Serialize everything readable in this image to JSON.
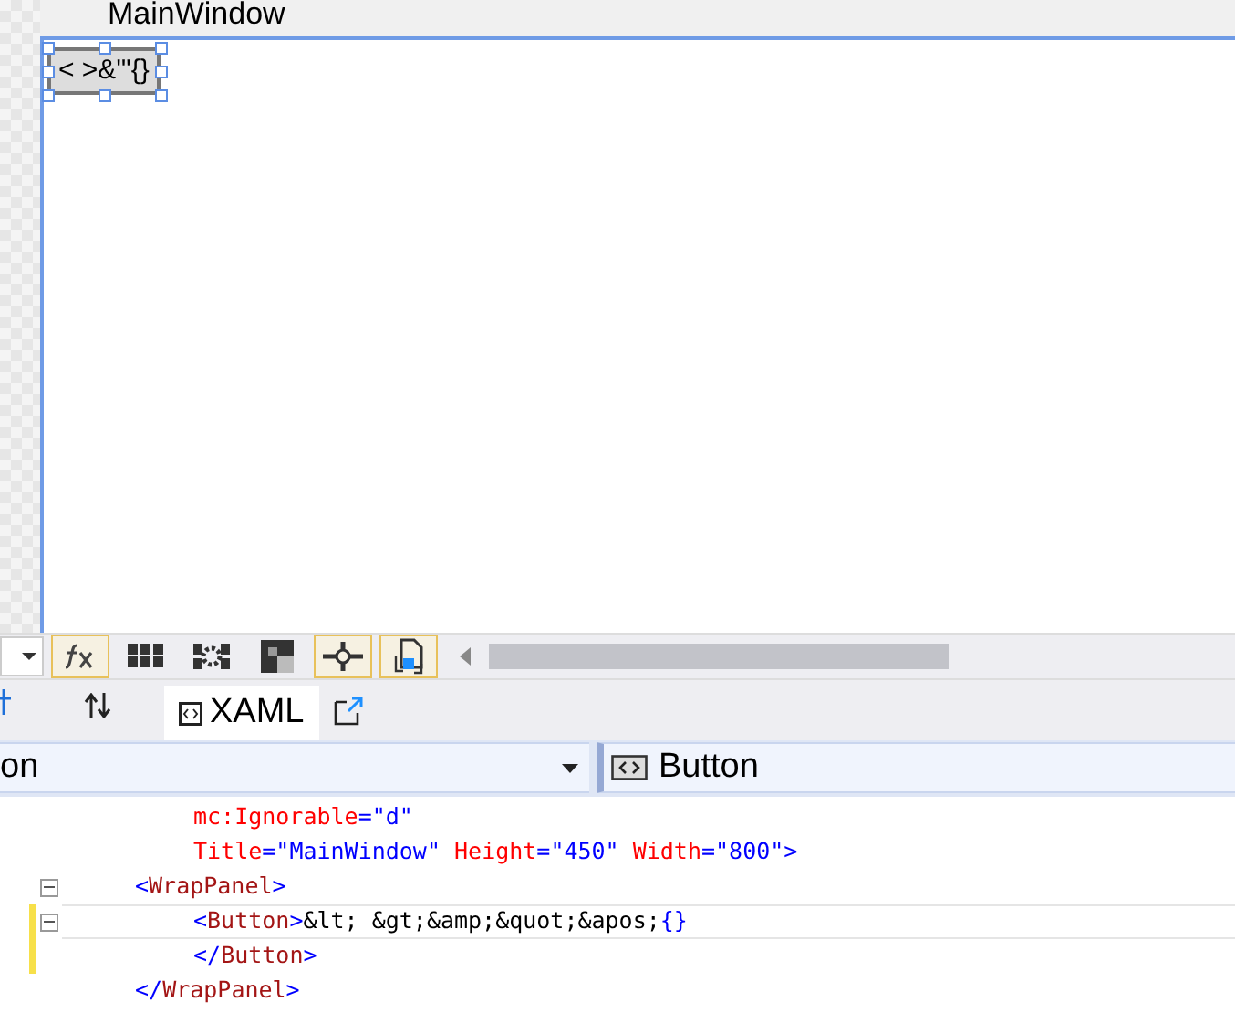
{
  "designer": {
    "window_title": "MainWindow",
    "button_content": "< >&\"'{}",
    "button_selected": true
  },
  "toolbar": {
    "tools": [
      {
        "kind": "fx",
        "on": true
      },
      {
        "kind": "grid",
        "on": false
      },
      {
        "kind": "grid-gear",
        "on": false
      },
      {
        "kind": "checker",
        "on": false
      },
      {
        "kind": "snap",
        "on": true
      },
      {
        "kind": "refresh-doc",
        "on": true
      }
    ]
  },
  "tabs": [
    {
      "label": "XAML",
      "selected": true
    }
  ],
  "selectors": [
    {
      "text": "on",
      "kind": "plain"
    },
    {
      "text": "Button",
      "kind": "element"
    }
  ],
  "code_lines": [
    {
      "kind": "attribute",
      "collapsible": false,
      "changed": false,
      "current": false,
      "tokens": [
        {
          "kind": "attr",
          "text": "mc:Ignorable"
        },
        {
          "kind": "punct",
          "text": "="
        },
        {
          "kind": "value",
          "text": "\"d\""
        }
      ]
    },
    {
      "kind": "attribute",
      "collapsible": false,
      "changed": false,
      "current": false,
      "tokens": [
        {
          "kind": "attr",
          "text": "Title"
        },
        {
          "kind": "punct",
          "text": "="
        },
        {
          "kind": "value",
          "text": "\"MainWindow\" "
        },
        {
          "kind": "attr",
          "text": "Height"
        },
        {
          "kind": "punct",
          "text": "="
        },
        {
          "kind": "value",
          "text": "\"450\" "
        },
        {
          "kind": "attr",
          "text": "Width"
        },
        {
          "kind": "punct",
          "text": "="
        },
        {
          "kind": "value",
          "text": "\"800\""
        },
        {
          "kind": "punct",
          "text": ">"
        }
      ]
    },
    {
      "kind": "tag",
      "collapsible": true,
      "changed": false,
      "current": false,
      "tokens": [
        {
          "kind": "punct",
          "text": "<"
        },
        {
          "kind": "element",
          "text": "WrapPanel"
        },
        {
          "kind": "punct",
          "text": ">"
        }
      ],
      "children": [
        {
          "kind": "tag",
          "collapsible": true,
          "changed": true,
          "current": true,
          "tokens": [
            {
              "kind": "punct",
              "text": "<"
            },
            {
              "kind": "element",
              "text": "Button"
            },
            {
              "kind": "punct",
              "text": ">"
            },
            {
              "kind": "text",
              "text": "&lt; &gt;&amp;&quot;&apos;"
            },
            {
              "kind": "value",
              "text": "{}"
            }
          ]
        },
        {
          "kind": "tag",
          "collapsible": false,
          "changed": true,
          "current": false,
          "tokens": [
            {
              "kind": "punct",
              "text": "</"
            },
            {
              "kind": "element",
              "text": "Button"
            },
            {
              "kind": "punct",
              "text": ">"
            }
          ]
        }
      ]
    },
    {
      "kind": "tag",
      "collapsible": false,
      "changed": false,
      "current": false,
      "tokens": [
        {
          "kind": "punct",
          "text": "</"
        },
        {
          "kind": "element",
          "text": "WrapPanel"
        },
        {
          "kind": "punct",
          "text": ">"
        }
      ]
    }
  ]
}
